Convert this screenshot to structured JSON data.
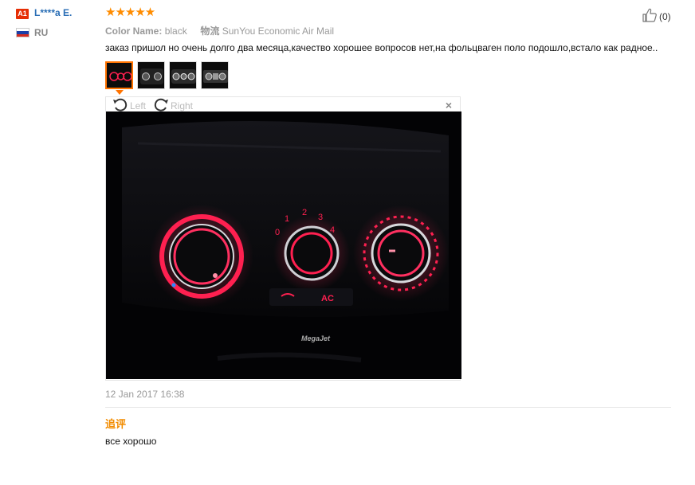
{
  "reviewer": {
    "badge": "A1",
    "name": "L****a E.",
    "country": "RU"
  },
  "review": {
    "stars": 5,
    "star_glyphs": "★★★★★",
    "color_label": "Color Name:",
    "color_value": "black",
    "shipping_label": "物流",
    "shipping_value": "SunYou Economic Air Mail",
    "text": "заказ пришол но очень долго два месяца,качество хорошее вопросов нет,на фольцваген поло подошло,встало как радное..",
    "date": "12 Jan 2017 16:38",
    "helpful_count": "(0)"
  },
  "viewer": {
    "rotate_left": "Left",
    "rotate_right": "Right",
    "close": "×",
    "photo_brand": "MegaJet",
    "dial_labels": {
      "fan": [
        "0",
        "1",
        "2",
        "3",
        "4"
      ],
      "ac": "AC"
    }
  },
  "thumbnails": [
    {
      "name": "photo-1",
      "active": true
    },
    {
      "name": "photo-2",
      "active": false
    },
    {
      "name": "photo-3",
      "active": false
    },
    {
      "name": "photo-4",
      "active": false
    }
  ],
  "additional": {
    "title": "追评",
    "text": "все хорошо"
  },
  "colors": {
    "star": "#ff8c00",
    "name_link": "#2a6eb5",
    "accent_orange": "#ff7300",
    "additional_title": "#f28c00",
    "led_red": "#ff1f4f"
  }
}
